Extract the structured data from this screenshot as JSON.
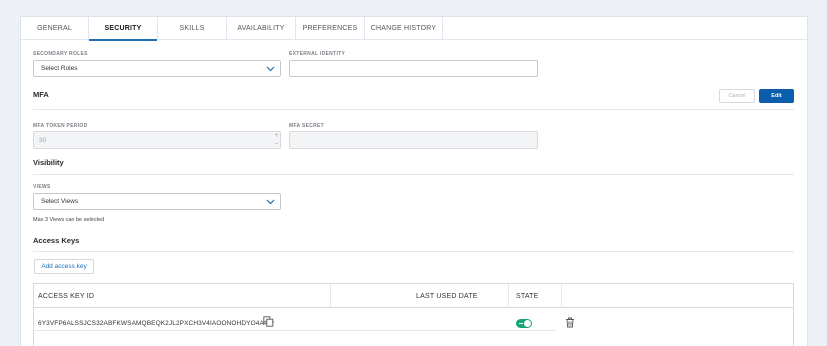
{
  "tabs": [
    {
      "label": "GENERAL"
    },
    {
      "label": "SECURITY"
    },
    {
      "label": "SKILLS"
    },
    {
      "label": "AVAILABILITY"
    },
    {
      "label": "PREFERENCES"
    },
    {
      "label": "CHANGE HISTORY"
    }
  ],
  "active_tab": "SECURITY",
  "roles": {
    "secondary_label": "SECONDARY ROLES",
    "secondary_value": "Select Roles",
    "external_label": "EXTERNAL IDENTITY",
    "external_value": ""
  },
  "mfa": {
    "title": "MFA",
    "cancel_label": "Cancel",
    "edit_label": "Edit",
    "token_period_label": "MFA TOKEN PERIOD",
    "token_period_value": "30",
    "plus": "+",
    "minus": "−",
    "secret_label": "MFA SECRET",
    "secret_value": ""
  },
  "visibility": {
    "title": "Visibility",
    "views_label": "VIEWS",
    "views_value": "Select Views",
    "helper": "Max 3 Views can be selected"
  },
  "access_keys": {
    "title": "Access Keys",
    "add_label": "Add access key",
    "columns": [
      "ACCESS KEY ID",
      "LAST USED DATE",
      "STATE"
    ],
    "rows": [
      {
        "key_id": "6Y3VFP6ALSSJCS32ABFKWSAMQBEQK2JL2PXCH3V4IAOONOHDYO4A****",
        "last_used": "",
        "state_on": true
      }
    ]
  },
  "colors": {
    "accent": "#0b5cab",
    "tab_underline": "#1f6fb6",
    "toggle_on": "#16a673"
  },
  "icons": [
    "chevron-down-icon",
    "copy-icon",
    "trash-icon"
  ]
}
